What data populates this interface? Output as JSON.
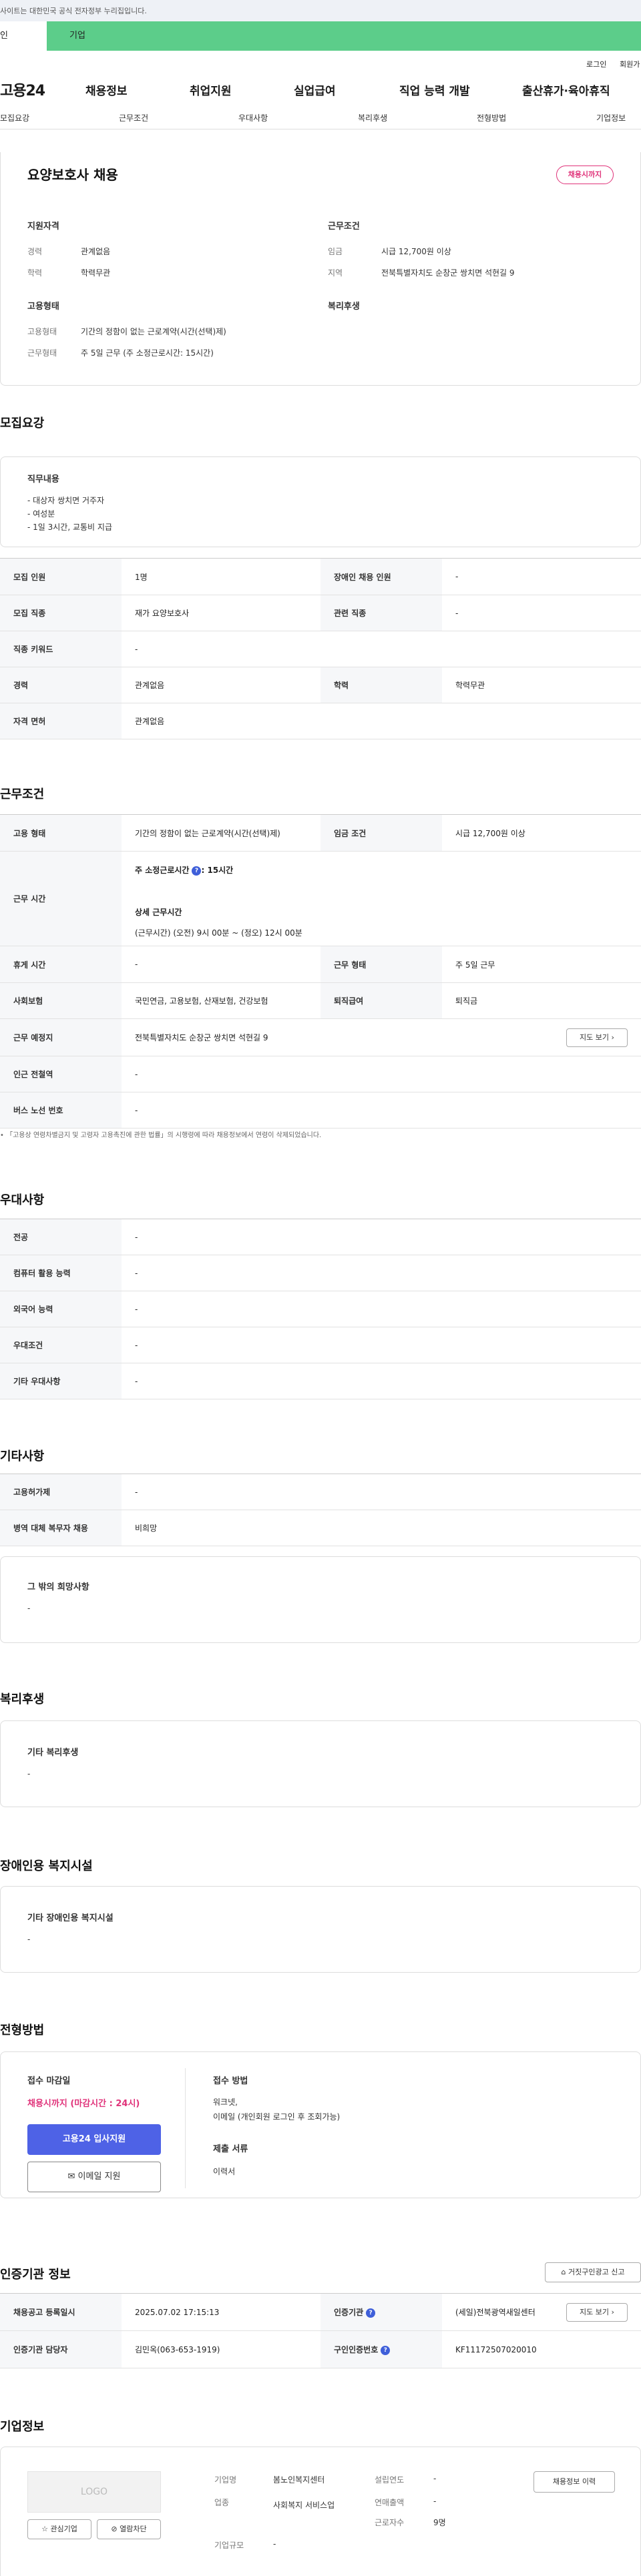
{
  "top": {
    "banner": "사이트는 대한민국 공식 전자정부 누리집입니다.",
    "tabs": [
      "인",
      "기업"
    ],
    "util": [
      "로그인",
      "회원가"
    ]
  },
  "gnb": {
    "logo": "고용24",
    "menus": [
      "채용정보",
      "취업지원",
      "실업급여",
      "직업 능력 개발",
      "출산휴가·육아휴직"
    ]
  },
  "subtabs": [
    "모집요강",
    "근무조건",
    "우대사항",
    "복리후생",
    "전형방법",
    "기업정보"
  ],
  "job": {
    "title": "요양보호사 채용",
    "badge": "채용시까지",
    "qual_heading": "지원자격",
    "career_label": "경력",
    "career": "관계없음",
    "edu_label": "학력",
    "edu": "학력무관",
    "cond_heading": "근무조건",
    "wage_label": "임금",
    "wage": "시급 12,700원 이상",
    "region_label": "지역",
    "region": "전북특별자치도 순창군 쌍치면 석현길 9",
    "emp_heading": "고용형태",
    "emptype_label": "고용형태",
    "emptype": "기간의 정함이 없는 근로계약(시간(선택)제)",
    "worktype_label": "근무형태",
    "worktype": "주 5일 근무 (주 소정근로시간: 15시간)",
    "welfare_heading": "복리후생"
  },
  "recruit": {
    "heading": "모집요강",
    "duty_heading": "직무내용",
    "duties": [
      "- 대상자 쌍치면 거주자",
      "- 여성분",
      "- 1일 3시간, 교통비 지급"
    ],
    "rows": [
      {
        "k1": "모집 인원",
        "v1": "1명",
        "k2": "장애인 채용 인원",
        "v2": "-"
      },
      {
        "k1": "모집 직종",
        "v1": "재가 요양보호사",
        "k2": "관련 직종",
        "v2": "-"
      },
      {
        "k1": "직종 키워드",
        "v1": "-"
      },
      {
        "k1": "경력",
        "v1": "관계없음",
        "k2": "학력",
        "v2": "학력무관"
      },
      {
        "k1": "자격 면허",
        "v1": "관계없음"
      }
    ]
  },
  "conditions": {
    "heading": "근무조건",
    "emp_k": "고용 형태",
    "emp_v": "기간의 정함이 없는 근로계약(시간(선택)제)",
    "wage_k": "임금 조건",
    "wage_v": "시급 12,700원 이상",
    "time_k": "근무 시간",
    "time_weekly_label": "주 소정근로시간",
    "time_weekly": ": 15시간",
    "time_detail_label": "상세 근무시간",
    "time_detail": "(근무시간) (오전) 9시 00분 ~ (정오) 12시 00분",
    "rest_k": "휴게 시간",
    "rest_v": "-",
    "form_k": "근무 형태",
    "form_v": "주 5일 근무",
    "ins_k": "사회보험",
    "ins_v": "국민연금, 고용보험, 산재보험, 건강보험",
    "sev_k": "퇴직급여",
    "sev_v": "퇴직금",
    "place_k": "근무 예정지",
    "place_v": "전북특별자치도 순창군 쌍치면 석현길 9",
    "map_btn": "지도 보기",
    "subway_k": "인근 전철역",
    "subway_v": "-",
    "bus_k": "버스 노선 번호",
    "bus_v": "-",
    "note": "「고용상 연령차별금지 및 고령자 고용촉진에 관한 법률」의 시행령에 따라 채용정보에서 연령이 삭제되었습니다."
  },
  "pref": {
    "heading": "우대사항",
    "rows": [
      {
        "k": "전공",
        "v": "-"
      },
      {
        "k": "컴퓨터 활용 능력",
        "v": "-"
      },
      {
        "k": "외국어 능력",
        "v": "-"
      },
      {
        "k": "우대조건",
        "v": "-"
      },
      {
        "k": "기타 우대사항",
        "v": "-"
      }
    ]
  },
  "etc": {
    "heading": "기타사항",
    "rows": [
      {
        "k": "고용허가제",
        "v": "-"
      },
      {
        "k": "병역 대체 복무자 채용",
        "v": "비희망"
      }
    ],
    "other_heading": "그 밖의 희망사항",
    "other_value": "-"
  },
  "welfare": {
    "heading": "복리후생",
    "card_heading": "기타 복리후생",
    "card_value": "-"
  },
  "disabled": {
    "heading": "장애인용 복지시설",
    "card_heading": "기타 장애인용 복지시설",
    "card_value": "-"
  },
  "process": {
    "heading": "전형방법",
    "deadline_heading": "접수 마감일",
    "deadline": "채용시까지 (마감시간 : 24시)",
    "apply_btn": "고용24 입사지원",
    "email_btn": "이메일 지원",
    "method_heading": "접수 방법",
    "method_1": "워크넷,",
    "method_2": "이메일 (개인회원 로그인 후 조회가능)",
    "docs_heading": "제출 서류",
    "docs": "이력서"
  },
  "cert": {
    "heading": "인증기관 정보",
    "report_btn": "거짓구인광고 신고",
    "reg_k": "채용공고 등록일시",
    "reg_v": "2025.07.02 17:15:13",
    "org_k": "인증기관",
    "org_v": "(세일)전북광역새일센터",
    "map_btn": "지도 보기",
    "mgr_k": "인증기관 담당자",
    "mgr_v": "김민옥(063-653-1919)",
    "num_k": "구인인증번호",
    "num_v": "KF11172507020010"
  },
  "company": {
    "heading": "기업정보",
    "logo": "LOGO",
    "fav_btn": "관심기업",
    "block_btn": "열람차단",
    "name_k": "기업명",
    "name_v": "봄노인복지센터",
    "ind_k": "업종",
    "ind_v": "사회복지 서비스업",
    "size_k": "기업규모",
    "size_v": "-",
    "year_k": "설립연도",
    "year_v": "-",
    "sales_k": "연매출액",
    "sales_v": "-",
    "emp_k": "근로자수",
    "emp_v": "9명",
    "history_btn": "채용정보 이력"
  }
}
